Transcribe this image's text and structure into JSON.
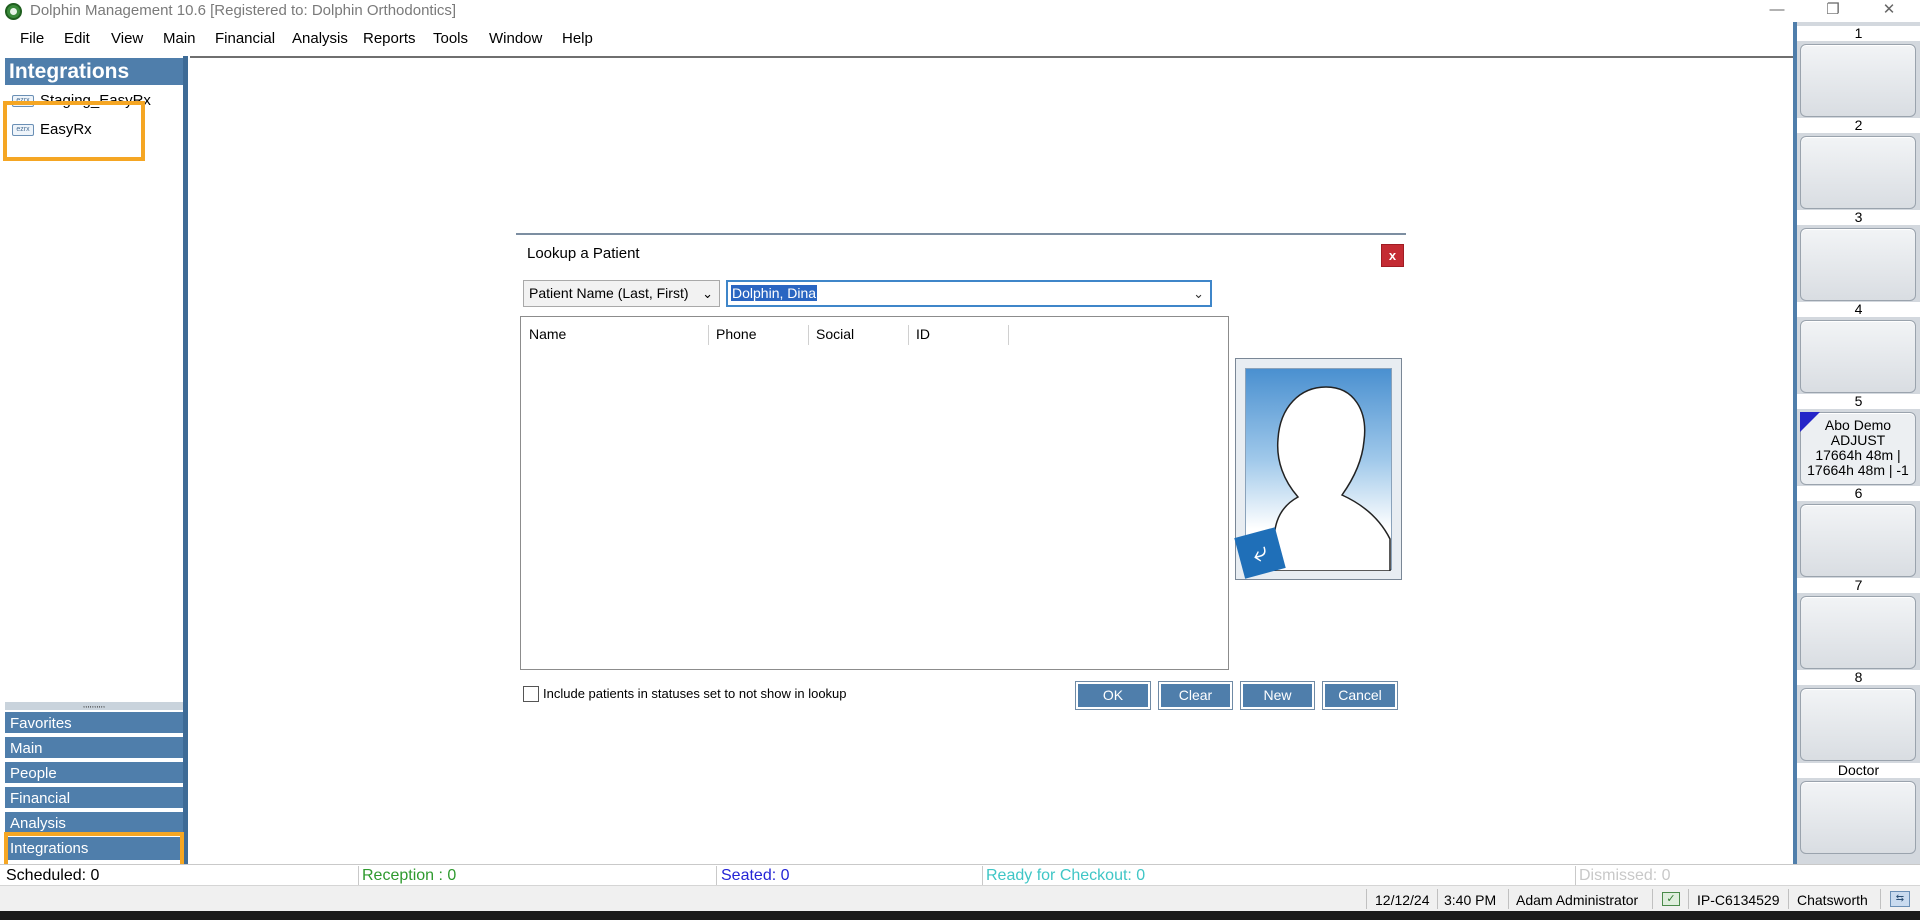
{
  "window": {
    "title": "Dolphin Management 10.6 [Registered to: Dolphin Orthodontics]",
    "minimize_glyph": "—",
    "restore_glyph": "❐",
    "close_glyph": "✕"
  },
  "menu": [
    "File",
    "Edit",
    "View",
    "Main",
    "Financial",
    "Analysis",
    "Reports",
    "Tools",
    "Window",
    "Help"
  ],
  "left_panel": {
    "header": "Integrations",
    "items": [
      {
        "label": "Staging_EasyRx",
        "icon": "integration-icon"
      },
      {
        "label": "EasyRx",
        "icon": "integration-icon"
      }
    ],
    "grip": ",,,,,,,,,,",
    "nav": [
      "Favorites",
      "Main",
      "People",
      "Financial",
      "Analysis",
      "Integrations"
    ]
  },
  "right_panel": {
    "slots": [
      "1",
      "2",
      "3",
      "4",
      "5",
      "6",
      "7",
      "8",
      "Doctor"
    ],
    "slot5": {
      "line1": "Abo Demo",
      "line2": "ADJUST",
      "line3": "17664h 48m |",
      "line4": "17664h 48m | -1"
    }
  },
  "dialog": {
    "title": "Lookup a Patient",
    "close": "x",
    "search_type": "Patient Name (Last, First)",
    "search_value": "Dolphin, Dina",
    "columns": [
      "Name",
      "Phone",
      "Social",
      "ID"
    ],
    "include_label": "Include patients in statuses set to not show in lookup",
    "buttons": {
      "ok": "OK",
      "clear": "Clear",
      "new": "New",
      "cancel": "Cancel"
    }
  },
  "status": {
    "scheduled": "Scheduled: 0",
    "reception": "Reception : 0",
    "seated": "Seated: 0",
    "ready": "Ready for Checkout: 0",
    "dismissed": "Dismissed: 0",
    "colors": {
      "reception": "#2e9a2e",
      "seated": "#2424d6",
      "ready": "#3fc6c6",
      "dismissed": "#c8c8c8"
    }
  },
  "info": {
    "date": "12/12/24",
    "time": "3:40 PM",
    "user": "Adam Administrator",
    "ip": "IP-C6134529",
    "location": "Chatsworth"
  },
  "colors": {
    "accent": "#4f7eab",
    "highlight": "#f5a623",
    "close": "#c42b33"
  }
}
